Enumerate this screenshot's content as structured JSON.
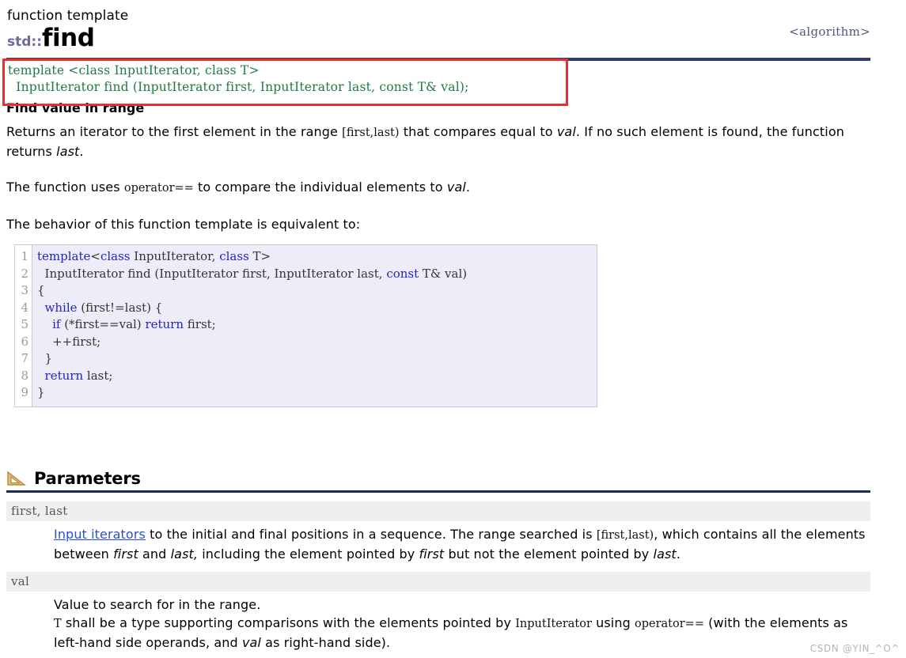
{
  "header": {
    "kind": "function template",
    "namespace": "std::",
    "name": "find",
    "include_tag": "<algorithm>"
  },
  "signature": {
    "line1": "template <class InputIterator, class T>",
    "line2": "  InputIterator find (InputIterator first, InputIterator last, const T& val);"
  },
  "annotation": {
    "box_color": "#e83030"
  },
  "brief": {
    "heading": "Find value in range",
    "para1_pre": "Returns an iterator to the first element in the range ",
    "para1_range": "[first,last)",
    "para1_mid": " that compares equal to ",
    "para1_val": "val",
    "para1_post": ". If no such element is found, the function returns ",
    "para1_last": "last",
    "para1_end": ".",
    "para2_pre": "The function uses ",
    "para2_code": "operator==",
    "para2_mid": " to compare the individual elements to ",
    "para2_val": "val",
    "para2_end": ".",
    "para3": "The behavior of this function template is equivalent to:"
  },
  "code_sample": {
    "line_numbers": [
      "1",
      "2",
      "3",
      "4",
      "5",
      "6",
      "7",
      "8",
      "9"
    ],
    "lines": [
      [
        {
          "t": "template",
          "k": true
        },
        {
          "t": "<",
          "k": false
        },
        {
          "t": "class",
          "k": true
        },
        {
          "t": " InputIterator, ",
          "k": false
        },
        {
          "t": "class",
          "k": true
        },
        {
          "t": " T>",
          "k": false
        }
      ],
      [
        {
          "t": "  InputIterator find (InputIterator first, InputIterator last, ",
          "k": false
        },
        {
          "t": "const",
          "k": true
        },
        {
          "t": " T& val)",
          "k": false
        }
      ],
      [
        {
          "t": "{",
          "k": false
        }
      ],
      [
        {
          "t": "  ",
          "k": false
        },
        {
          "t": "while",
          "k": true
        },
        {
          "t": " (first!=last) {",
          "k": false
        }
      ],
      [
        {
          "t": "    ",
          "k": false
        },
        {
          "t": "if",
          "k": true
        },
        {
          "t": " (*first==val) ",
          "k": false
        },
        {
          "t": "return",
          "k": true
        },
        {
          "t": " first;",
          "k": false
        }
      ],
      [
        {
          "t": "    ++first;",
          "k": false
        }
      ],
      [
        {
          "t": "  }",
          "k": false
        }
      ],
      [
        {
          "t": "  ",
          "k": false
        },
        {
          "t": "return",
          "k": true
        },
        {
          "t": " last;",
          "k": false
        }
      ],
      [
        {
          "t": "}",
          "k": false
        }
      ]
    ]
  },
  "parameters": {
    "section_title": "Parameters",
    "icon": "triangle-ruler-icon",
    "items": [
      {
        "names": "first, last",
        "desc_link": "Input iterators",
        "desc_pre": " to the initial and final positions in a sequence. The range searched is ",
        "desc_range": "[first,last)",
        "desc_mid": ", which contains all the elements between ",
        "desc_em1": "first",
        "desc_mid2": " and ",
        "desc_em2": "last,",
        "desc_mid3": " including the element pointed by ",
        "desc_em3": "first",
        "desc_mid4": " but not the element pointed by ",
        "desc_em4": "last",
        "desc_end": "."
      },
      {
        "names": "val",
        "line1": "Value to search for in the range.",
        "line2_t": "T",
        "line2_pre": " shall be a type supporting comparisons with the elements pointed by ",
        "line2_code": "InputIterator",
        "line2_mid": " using ",
        "line2_op": "operator==",
        "line2_post": " (with the elements as left-hand side operands, and ",
        "line2_em": "val",
        "line2_end": " as right-hand side)."
      }
    ]
  },
  "watermark": "CSDN @YIN_^O^"
}
